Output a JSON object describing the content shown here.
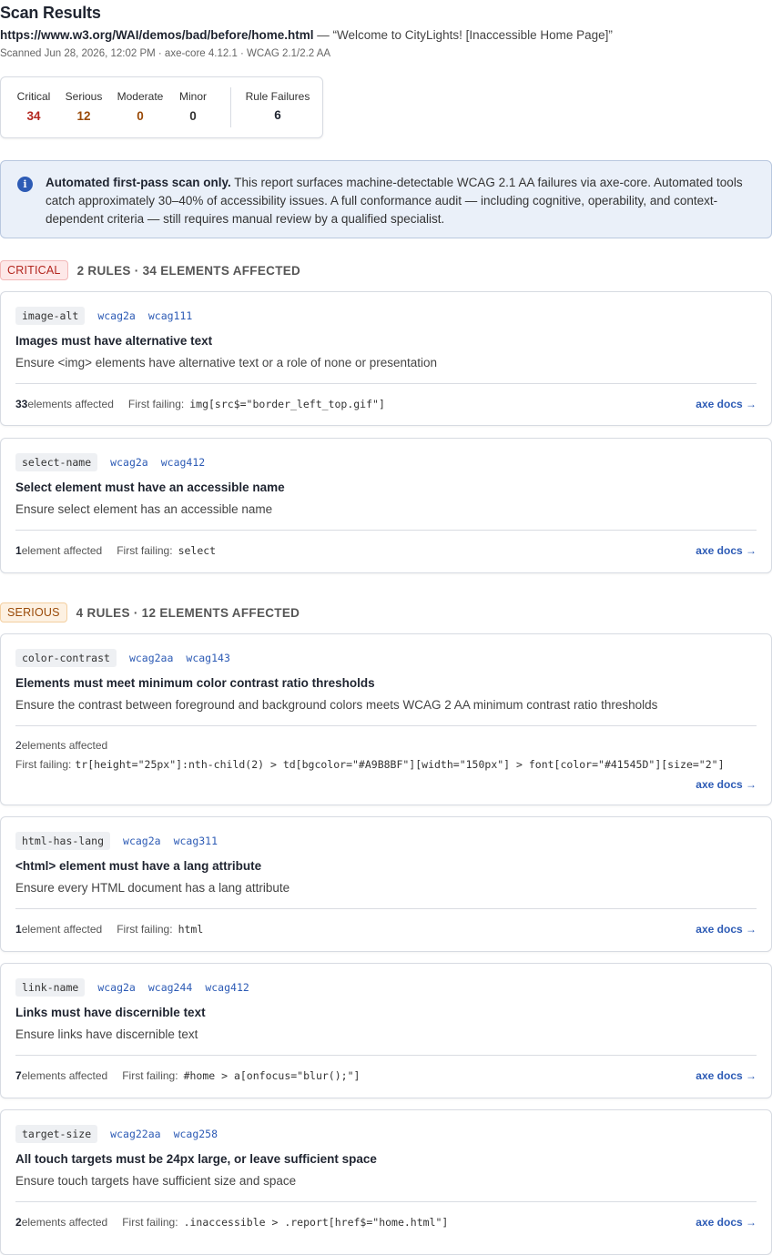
{
  "header": {
    "title": "Scan Results",
    "url": "https://www.w3.org/WAI/demos/bad/before/home.html",
    "page_title": " — “Welcome to CityLights! [Inaccessible Home Page]”",
    "meta": "Scanned Jun 28, 2026, 12:02 PM · axe-core 4.12.1 · WCAG 2.1/2.2 AA"
  },
  "summary": {
    "critical": {
      "label": "Critical",
      "value": "34",
      "color": "#b3261e"
    },
    "serious": {
      "label": "Serious",
      "value": "12",
      "color": "#9a4a08"
    },
    "moderate": {
      "label": "Moderate",
      "value": "0",
      "color": "#9a4a08"
    },
    "minor": {
      "label": "Minor",
      "value": "0",
      "color": "#333333"
    },
    "rule_failures": {
      "label": "Rule Failures",
      "value": "6"
    }
  },
  "notice": {
    "icon": "info-icon",
    "bold": "Automated first-pass scan only.",
    "text": " This report surfaces machine-detectable WCAG 2.1 AA failures via axe-core. Automated tools catch approximately 30–40% of accessibility issues. A full conformance audit — including cognitive, operability, and context-dependent criteria — still requires manual review by a qualified specialist."
  },
  "groups": {
    "critical": {
      "label": "CRITICAL",
      "count": "2 RULES · 34 ELEMENTS AFFECTED"
    },
    "serious": {
      "label": "SERIOUS",
      "count": "4 RULES · 12 ELEMENTS AFFECTED"
    }
  },
  "rules": [
    {
      "id": "image-alt",
      "tags": [
        "wcag2a",
        "wcag111"
      ],
      "title": "Images must have alternative text",
      "desc": "Ensure <img> elements have alternative text or a role of none or presentation",
      "count": "33",
      "count_suffix": " elements affected",
      "ff_label": "First failing:",
      "selector": "img[src$=\"border_left_top.gif\"]",
      "docs": "axe docs →"
    },
    {
      "id": "select-name",
      "tags": [
        "wcag2a",
        "wcag412"
      ],
      "title": "Select element must have an accessible name",
      "desc": "Ensure select element has an accessible name",
      "count": "1",
      "count_suffix": " element affected",
      "ff_label": "First failing:",
      "selector": "select",
      "docs": "axe docs →"
    },
    {
      "id": "color-contrast",
      "tags": [
        "wcag2aa",
        "wcag143"
      ],
      "title": "Elements must meet minimum color contrast ratio thresholds",
      "desc": "Ensure the contrast between foreground and background colors meets WCAG 2 AA minimum contrast ratio thresholds",
      "count": "2",
      "count_suffix": " elements affected",
      "ff_label": "First failing:",
      "selector": "tr[height=\"25px\"]:nth-child(2) > td[bgcolor=\"#A9B8BF\"][width=\"150px\"] > font[color=\"#41545D\"][size=\"2\"]",
      "docs": "axe docs →"
    },
    {
      "id": "html-has-lang",
      "tags": [
        "wcag2a",
        "wcag311"
      ],
      "title": "<html> element must have a lang attribute",
      "desc": "Ensure every HTML document has a lang attribute",
      "count": "1",
      "count_suffix": " element affected",
      "ff_label": "First failing:",
      "selector": "html",
      "docs": "axe docs →"
    },
    {
      "id": "link-name",
      "tags": [
        "wcag2a",
        "wcag244",
        "wcag412"
      ],
      "title": "Links must have discernible text",
      "desc": "Ensure links have discernible text",
      "count": "7",
      "count_suffix": " elements affected",
      "ff_label": "First failing:",
      "selector": "#home > a[onfocus=\"blur();\"]",
      "docs": "axe docs →"
    },
    {
      "id": "target-size",
      "tags": [
        "wcag22aa",
        "wcag258"
      ],
      "title": "All touch targets must be 24px large, or leave sufficient space",
      "desc": "Ensure touch targets have sufficient size and space",
      "count": "2",
      "count_suffix": " elements affected",
      "ff_label": "First failing:",
      "selector": ".inaccessible > .report[href$=\"home.html\"]",
      "docs": "axe docs →"
    }
  ]
}
